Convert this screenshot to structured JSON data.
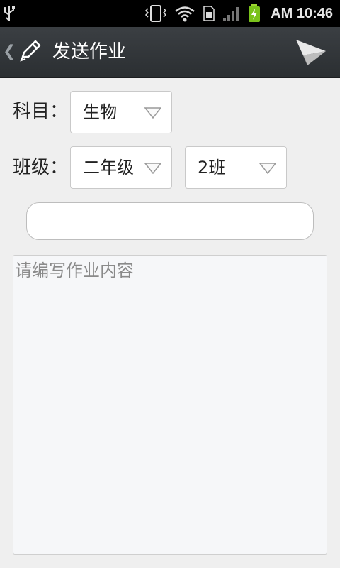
{
  "status_bar": {
    "time": "AM 10:46",
    "icons": [
      "usb-icon",
      "vibrate-icon",
      "wifi-icon",
      "sim-card-icon",
      "signal-icon",
      "battery-charging-icon"
    ]
  },
  "header": {
    "title": "发送作业",
    "back_icon": "chevron-left-icon",
    "edit_icon": "pencil-icon",
    "send_icon": "paper-plane-send-icon"
  },
  "form": {
    "subject_label": "科目：",
    "subject_value": "生物",
    "class_label": "班级：",
    "grade_value": "二年级",
    "class_value": "2班",
    "title_input_value": "",
    "content_placeholder": "请编写作业内容"
  },
  "colors": {
    "status_bar_bg": "#000000",
    "action_bar_bg": "#33373a",
    "page_bg": "#efefef"
  }
}
